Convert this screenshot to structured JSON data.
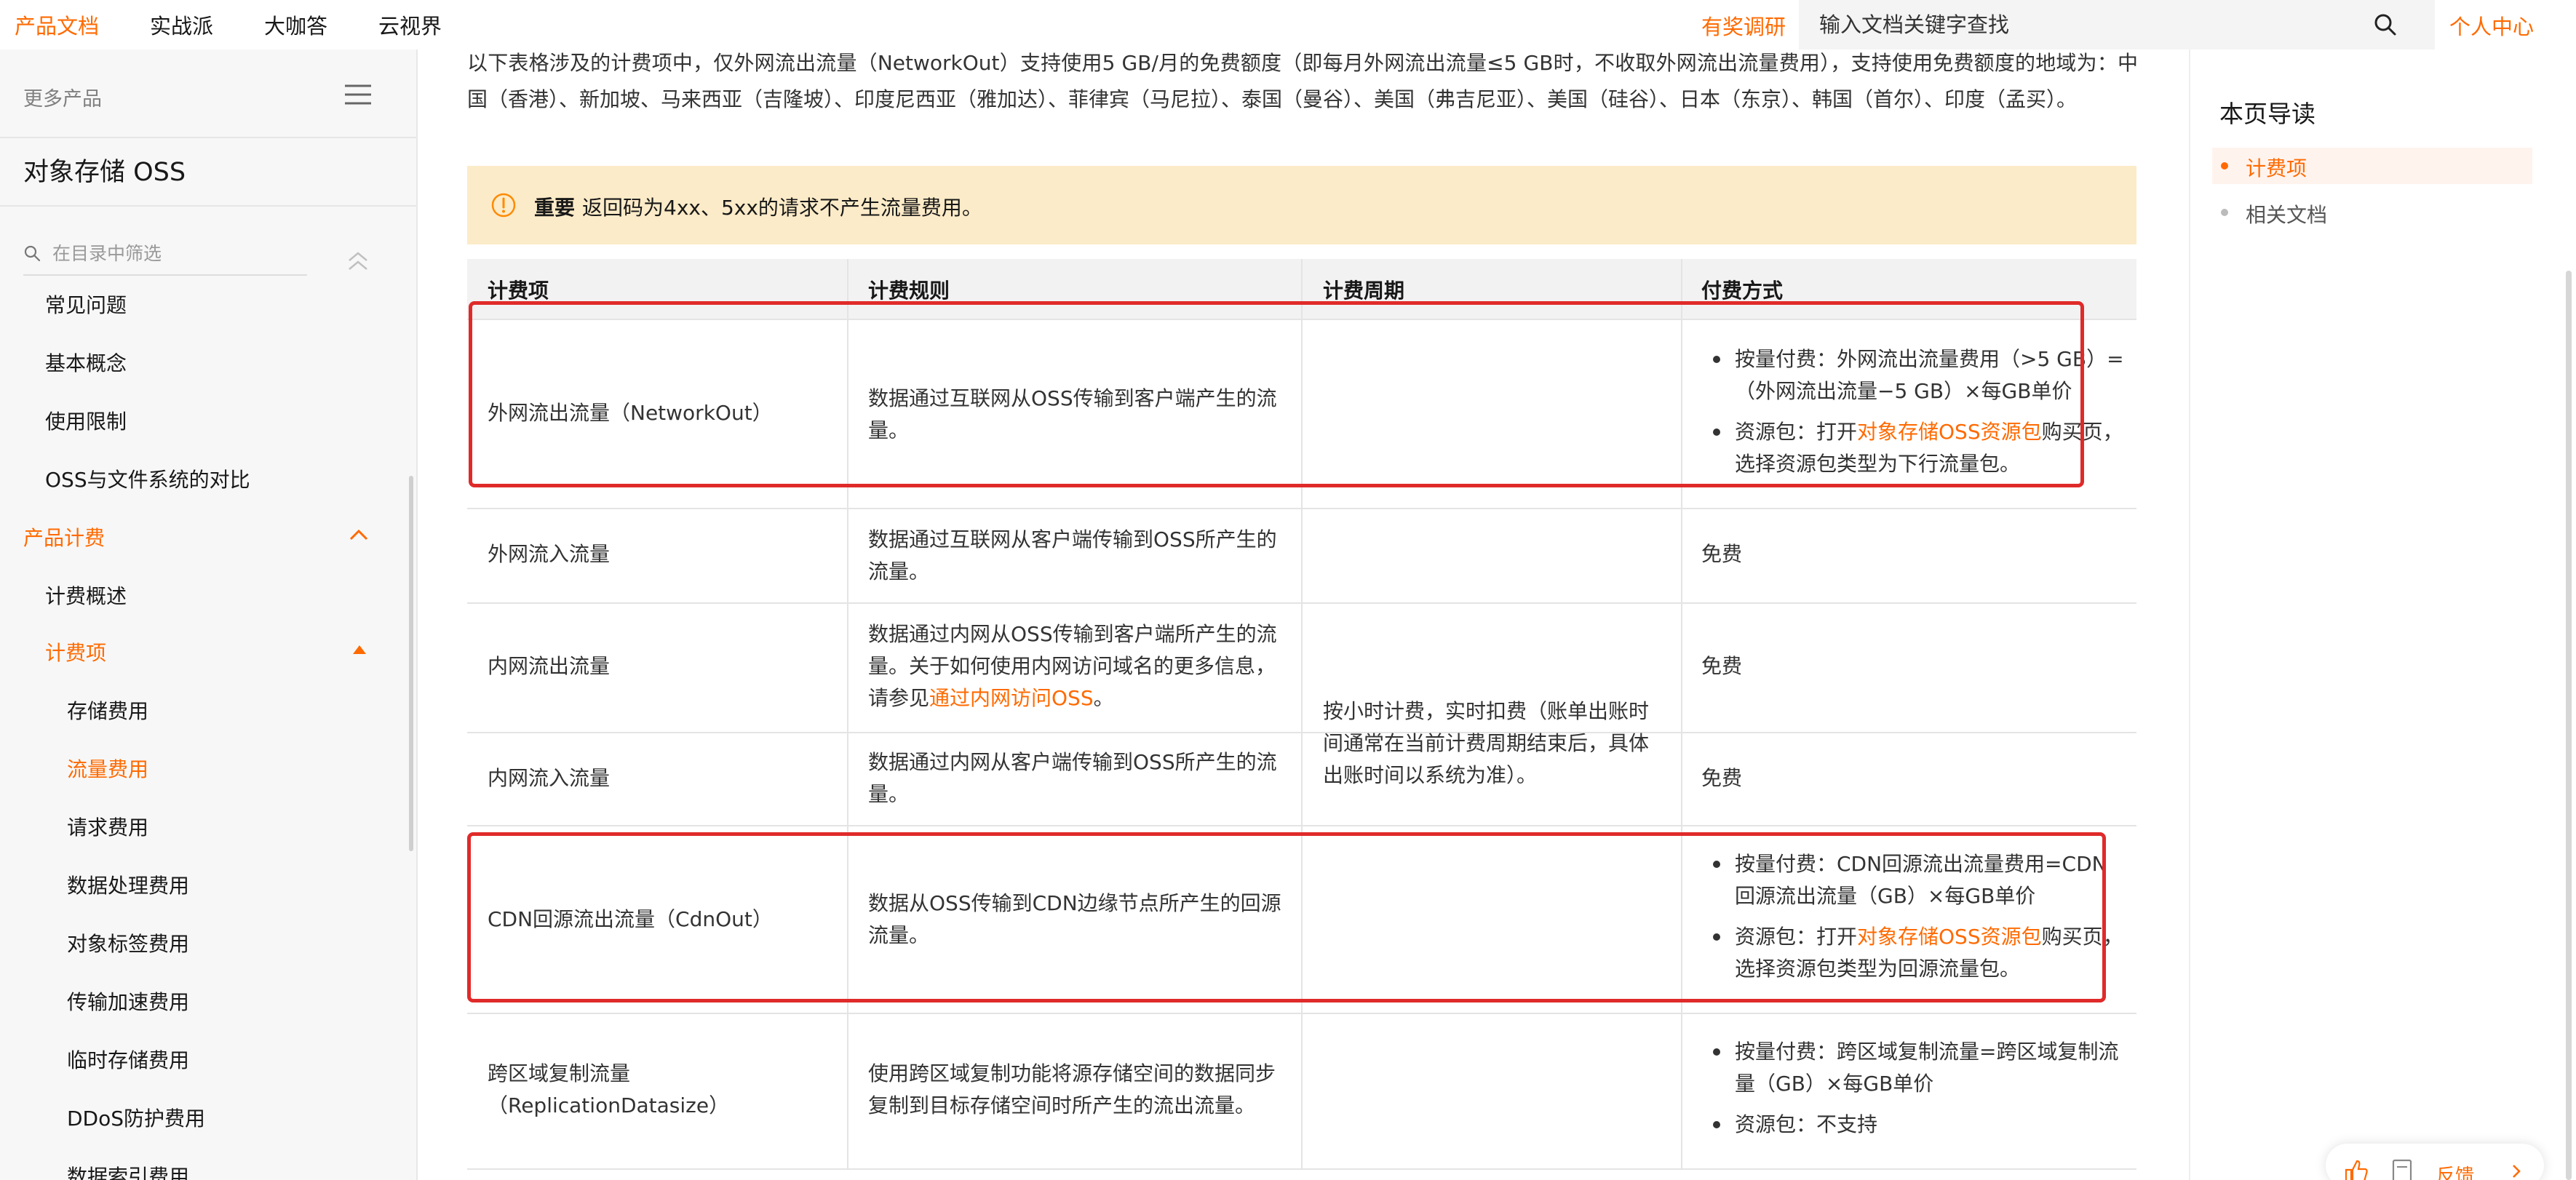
{
  "topnav": {
    "items": [
      "产品文档",
      "实战派",
      "大咖答",
      "云视界"
    ],
    "active_color": "#ff6a00",
    "survey": "有奖调研",
    "search_placeholder": "输入文档关键字查找",
    "user_center": "个人中心"
  },
  "sidebar": {
    "more_products": "更多产品",
    "product_title": "对象存储 OSS",
    "filter_placeholder": "在目录中筛选",
    "items": [
      "常见问题",
      "基本概念",
      "使用限制",
      "OSS与文件系统的对比"
    ],
    "section": "产品计费",
    "section_items": [
      "计费概述"
    ],
    "subsection": "计费项",
    "sub_items": [
      "存储费用",
      "流量费用",
      "请求费用",
      "数据处理费用",
      "对象标签费用",
      "传输加速费用",
      "临时存储费用",
      "DDoS防护费用",
      "数据索引费用"
    ],
    "current_item": "流量费用"
  },
  "content": {
    "intro": "以下表格涉及的计费项中，仅外网流出流量（NetworkOut）支持使用5 GB/月的免费额度（即每月外网流出流量≤5 GB时，不收取外网流出流量费用），支持使用免费额度的地域为：中国（香港）、新加坡、马来西亚（吉隆坡）、印度尼西亚（雅加达）、菲律宾（马尼拉）、泰国（曼谷）、美国（弗吉尼亚）、美国（硅谷）、日本（东京）、韩国（首尔）、印度（孟买）。",
    "notice_title": "重要",
    "notice_text": "返回码为4xx、5xx的请求不产生流量费用。",
    "table": {
      "headers": [
        "计费项",
        "计费规则",
        "计费周期",
        "付费方式"
      ],
      "rows": [
        {
          "item": "外网流出流量（NetworkOut）",
          "rule": "数据通过互联网从OSS传输到客户端产生的流量。",
          "pay": {
            "b1": "按量付费：外网流出流量费用（>5 GB）=（外网流出流量−5 GB）×每GB单价",
            "b2_pre": "资源包：打开",
            "b2_link": "对象存储OSS资源包",
            "b2_post": "购买页，选择资源包类型为下行流量包。"
          }
        },
        {
          "item": "外网流入流量",
          "rule": "数据通过互联网从客户端传输到OSS所产生的流量。",
          "pay": "免费"
        },
        {
          "item": "内网流出流量",
          "rule_pre": "数据通过内网从OSS传输到客户端所产生的流量。关于如何使用内网访问域名的更多信息，请参见",
          "rule_link": "通过内网访问OSS",
          "rule_post": "。",
          "pay": "免费"
        },
        {
          "item": "内网流入流量",
          "rule": "数据通过内网从客户端传输到OSS所产生的流量。",
          "pay": "免费"
        },
        {
          "item": "CDN回源流出流量（CdnOut）",
          "rule": "数据从OSS传输到CDN边缘节点所产生的回源流量。",
          "pay": {
            "b1": "按量付费：CDN回源流出流量费用=CDN回源流出流量（GB）×每GB单价",
            "b2_pre": "资源包：打开",
            "b2_link": "对象存储OSS资源包",
            "b2_post": "购买页，选择资源包类型为回源流量包。"
          }
        },
        {
          "item": "跨区域复制流量（ReplicationDatasize）",
          "rule": "使用跨区域复制功能将源存储空间的数据同步复制到目标存储空间时所产生的流出流量。",
          "pay": {
            "b1": "按量付费：跨区域复制流量=跨区域复制流量（GB）×每GB单价",
            "b2": "资源包：不支持"
          }
        }
      ],
      "cycle": "按小时计费，实时扣费（账单出账时间通常在当前计费周期结束后，具体出账时间以系统为准）。"
    }
  },
  "page_toc": {
    "title": "本页导读",
    "items": [
      "计费项",
      "相关文档"
    ]
  },
  "feedback": {
    "label": "反馈"
  },
  "colors": {
    "accent": "#ff6a00",
    "highlight": "#e02a2a",
    "notice_bg": "#fcebc8"
  }
}
